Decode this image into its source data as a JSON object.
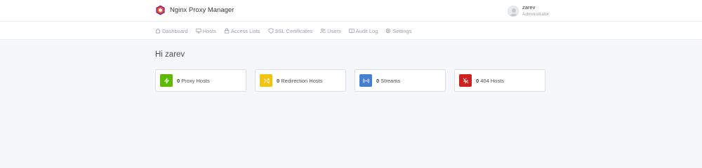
{
  "app": {
    "title": "Nginx Proxy Manager"
  },
  "user": {
    "name": "zarev",
    "role": "Administrator"
  },
  "nav": {
    "items": [
      {
        "label": "Dashboard",
        "icon": "home-icon"
      },
      {
        "label": "Hosts",
        "icon": "monitor-icon"
      },
      {
        "label": "Access Lists",
        "icon": "lock-icon"
      },
      {
        "label": "SSL Certificates",
        "icon": "shield-icon"
      },
      {
        "label": "Users",
        "icon": "users-icon"
      },
      {
        "label": "Audit Log",
        "icon": "book-icon"
      },
      {
        "label": "Settings",
        "icon": "gear-icon"
      }
    ]
  },
  "greeting": "Hi zarev",
  "cards": [
    {
      "count": "0",
      "label": "Proxy Hosts",
      "icon": "zap-icon",
      "color": "#5eba00"
    },
    {
      "count": "0",
      "label": "Redirection Hosts",
      "icon": "shuffle-icon",
      "color": "#f1c40f"
    },
    {
      "count": "0",
      "label": "Streams",
      "icon": "radio-icon",
      "color": "#467fcf"
    },
    {
      "count": "0",
      "label": "404 Hosts",
      "icon": "zap-off-icon",
      "color": "#cd201f"
    }
  ],
  "colors": {
    "brand_orange": "#f15833",
    "brand_purple": "#7a2a8f"
  }
}
